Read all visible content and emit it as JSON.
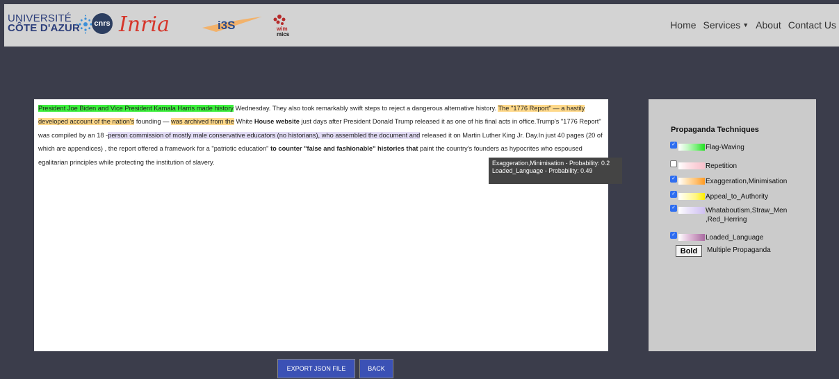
{
  "header": {
    "logos": {
      "uca_line1": "UNIVERSITÉ",
      "uca_line2": "CÔTE D'AZUR",
      "cnrs": "cnrs",
      "inria": "Inria",
      "i3s": "i3S",
      "wimmics_top": "wim",
      "wimmics_bottom": "mics"
    },
    "nav": {
      "home": "Home",
      "services": "Services",
      "about": "About",
      "contact": "Contact Us"
    }
  },
  "document": {
    "segments": [
      {
        "text": "President Joe Biden and Vice President Kamala Harris made history",
        "style": "flag"
      },
      {
        "text": " Wednesday. They also took remarkably swift steps to reject a dangerous alternative history. ",
        "style": ""
      },
      {
        "text": "The \"1776 Report\" — a hastily developed account of the nation's",
        "style": "exag"
      },
      {
        "text": " founding — ",
        "style": ""
      },
      {
        "text": "was archived from the",
        "style": "exag"
      },
      {
        "text": " White ",
        "style": ""
      },
      {
        "text": "House website",
        "style": "bold"
      },
      {
        "text": " just days after President Donald Trump released it as one of his final acts in office.Trump's \"1776 Report\" was compiled by an 18 -",
        "style": ""
      },
      {
        "text": "person commission of mostly male conservative educators (no historians), who assembled the document and",
        "style": "loaded"
      },
      {
        "text": " released it on Martin Luther King Jr. Day.In just 40 pages (20 of which are appendices) , the report offered a framework for a \"patriotic education\" ",
        "style": ""
      },
      {
        "text": "to counter \"false and fashionable\" histories that",
        "style": "bold"
      },
      {
        "text": " paint the country's founders as hypocrites who espoused egalitarian principles while protecting the institution of slavery.",
        "style": ""
      }
    ]
  },
  "tooltip": {
    "line1": "Exaggeration,Minimisation - Probability: 0.2",
    "line2": "Loaded_Language - Probability: 0.49"
  },
  "panel": {
    "title": "Propaganda Techniques",
    "techniques": [
      {
        "label": "Flag-Waving",
        "checked": true,
        "colors": [
          "#ffffff",
          "#c8f8c8",
          "#7cf07c",
          "#22e022"
        ]
      },
      {
        "label": "Repetition",
        "checked": false,
        "colors": [
          "#ffffff",
          "#fde4e8",
          "#fbd0d8",
          "#f8c0cb"
        ]
      },
      {
        "label": "Exaggeration,Minimisation",
        "checked": true,
        "colors": [
          "#ffffff",
          "#ffe0b0",
          "#ffc070",
          "#ff9a20"
        ]
      },
      {
        "label": "Appeal_to_Authority",
        "checked": true,
        "colors": [
          "#ffffff",
          "#fffbc0",
          "#fff580",
          "#ffee00"
        ]
      },
      {
        "label": "Whataboutism,Straw_Men\n,Red_Herring",
        "checked": true,
        "colors": [
          "#ffffff",
          "#ece6fa",
          "#ddd2f6",
          "#cfc0f0"
        ]
      },
      {
        "label": "Loaded_Language",
        "checked": true,
        "colors": [
          "#ffffff",
          "#e6c8e0",
          "#c99ac0",
          "#a86aa0"
        ]
      }
    ],
    "bold_sample": "Bold",
    "bold_desc": "Multiple Propaganda"
  },
  "buttons": {
    "export": "EXPORT JSON FILE",
    "back": "BACK"
  }
}
